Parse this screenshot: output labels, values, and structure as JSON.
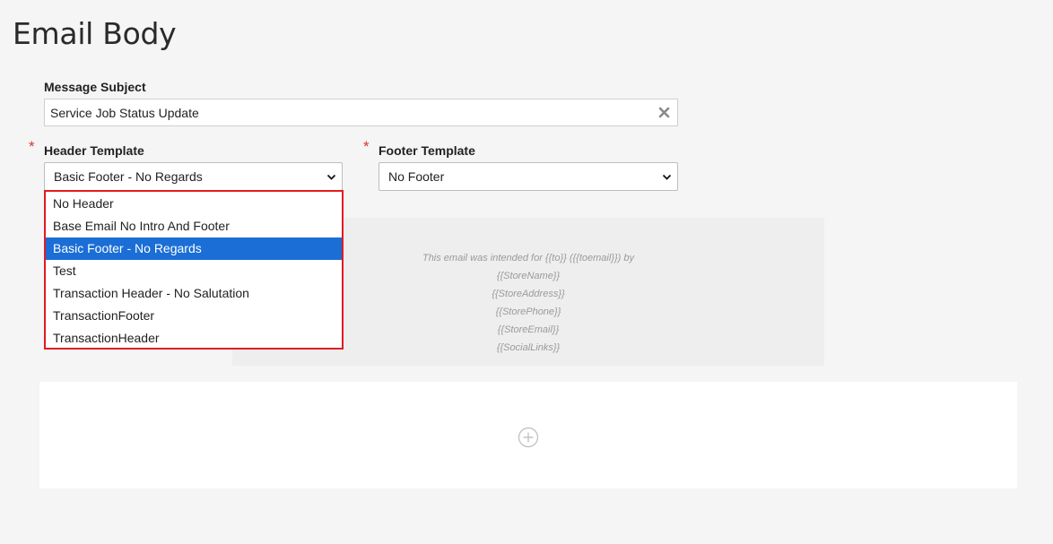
{
  "page": {
    "title": "Email Body"
  },
  "subject": {
    "label": "Message Subject",
    "value": "Service Job Status Update"
  },
  "header_template": {
    "required_mark": "*",
    "label": "Header Template",
    "selected": "Basic Footer - No Regards",
    "options": [
      {
        "label": "No Header",
        "selected": false
      },
      {
        "label": "Base Email No Intro And Footer",
        "selected": false
      },
      {
        "label": "Basic Footer - No Regards",
        "selected": true
      },
      {
        "label": "Test",
        "selected": false
      },
      {
        "label": "Transaction Header - No Salutation",
        "selected": false
      },
      {
        "label": "TransactionFooter",
        "selected": false
      },
      {
        "label": "TransactionHeader",
        "selected": false
      }
    ]
  },
  "footer_template": {
    "required_mark": "*",
    "label": "Footer Template",
    "selected": "No Footer"
  },
  "footer_preview": {
    "lines": [
      "This email was intended for {{to}} ({{toemail}}) by",
      "{{StoreName}}",
      "{{StoreAddress}}",
      "{{StorePhone}}",
      "{{StoreEmail}}",
      "{{SocialLinks}}"
    ]
  },
  "colors": {
    "accent_red": "#e01b22",
    "selection_blue": "#1a6ed6",
    "required_red": "#d9342b"
  },
  "icons": {
    "clear": "close-icon",
    "dropdown": "chevron-down-icon",
    "add": "plus-circle-icon"
  }
}
